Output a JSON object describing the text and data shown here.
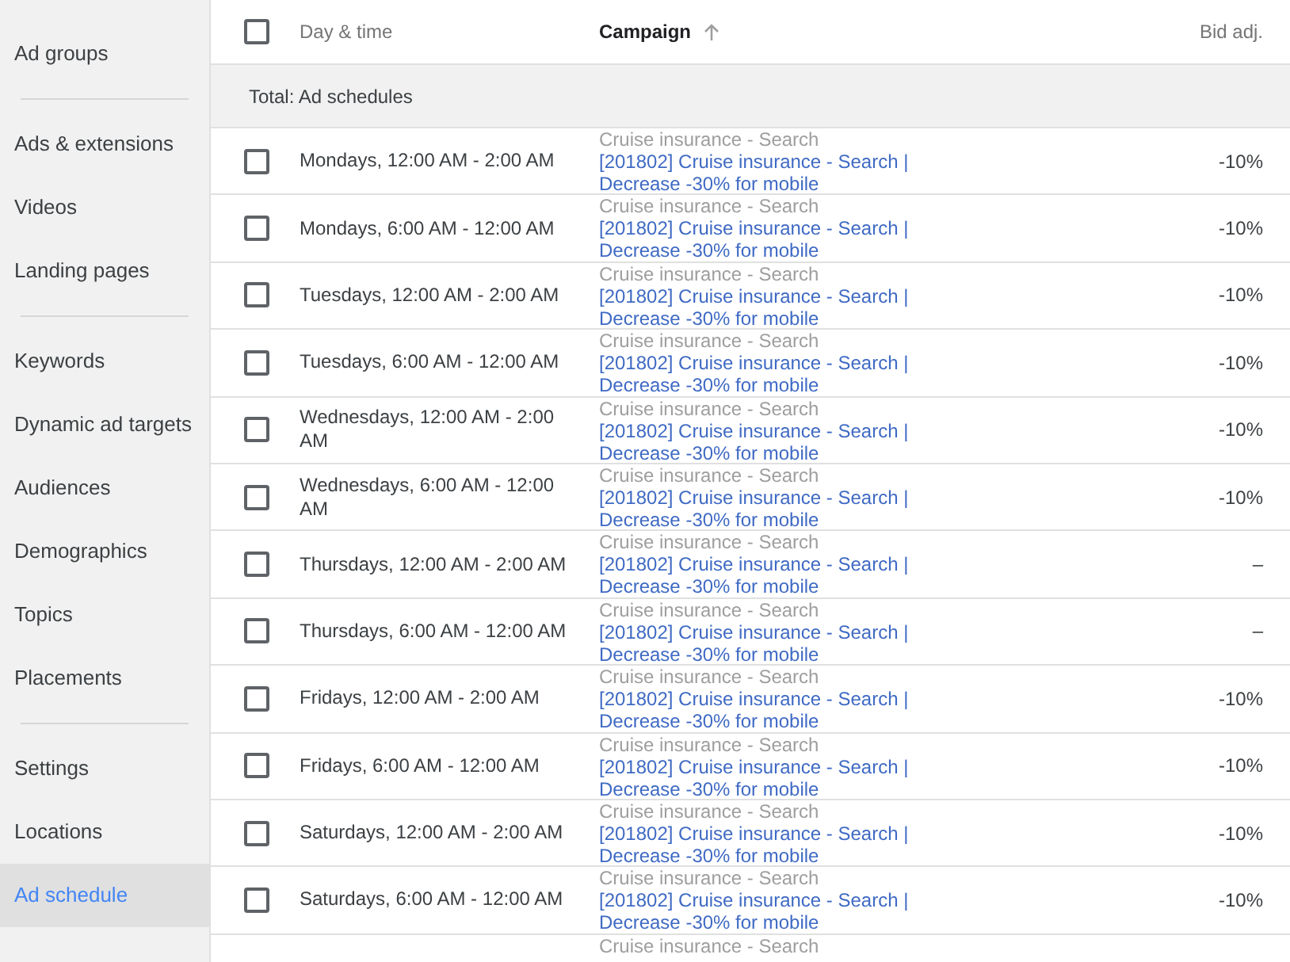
{
  "sidebar": {
    "groups": [
      {
        "items": [
          {
            "label": "Ad groups",
            "selected": false
          }
        ]
      },
      {
        "items": [
          {
            "label": "Ads & extensions",
            "selected": false
          },
          {
            "label": "Videos",
            "selected": false
          },
          {
            "label": "Landing pages",
            "selected": false
          }
        ]
      },
      {
        "items": [
          {
            "label": "Keywords",
            "selected": false
          },
          {
            "label": "Dynamic ad targets",
            "selected": false
          },
          {
            "label": "Audiences",
            "selected": false
          },
          {
            "label": "Demographics",
            "selected": false
          },
          {
            "label": "Topics",
            "selected": false
          },
          {
            "label": "Placements",
            "selected": false
          }
        ]
      },
      {
        "items": [
          {
            "label": "Settings",
            "selected": false
          },
          {
            "label": "Locations",
            "selected": false
          },
          {
            "label": "Ad schedule",
            "selected": true
          }
        ]
      }
    ]
  },
  "table": {
    "select_all_checked": false,
    "columns": [
      {
        "label": "Day & time",
        "sorted": false
      },
      {
        "label": "Campaign",
        "sorted": true
      },
      {
        "label": "Bid adj.",
        "sorted": false
      }
    ],
    "total_label": "Total: Ad schedules",
    "rows": [
      {
        "checked": false,
        "day_time": "Mondays, 12:00 AM - 2:00 AM",
        "campaign_group": "Cruise insurance - Search",
        "campaign": "[201802] Cruise insurance - Search | Decrease -30% for mobile",
        "bid_adj": "-10%"
      },
      {
        "checked": false,
        "day_time": "Mondays, 6:00 AM - 12:00 AM",
        "campaign_group": "Cruise insurance - Search",
        "campaign": "[201802] Cruise insurance - Search | Decrease -30% for mobile",
        "bid_adj": "-10%"
      },
      {
        "checked": false,
        "day_time": "Tuesdays, 12:00 AM - 2:00 AM",
        "campaign_group": "Cruise insurance - Search",
        "campaign": "[201802] Cruise insurance - Search | Decrease -30% for mobile",
        "bid_adj": "-10%"
      },
      {
        "checked": false,
        "day_time": "Tuesdays, 6:00 AM - 12:00 AM",
        "campaign_group": "Cruise insurance - Search",
        "campaign": "[201802] Cruise insurance - Search | Decrease -30% for mobile",
        "bid_adj": "-10%"
      },
      {
        "checked": false,
        "day_time": "Wednesdays, 12:00 AM - 2:00 AM",
        "campaign_group": "Cruise insurance - Search",
        "campaign": "[201802] Cruise insurance - Search | Decrease -30% for mobile",
        "bid_adj": "-10%"
      },
      {
        "checked": false,
        "day_time": "Wednesdays, 6:00 AM - 12:00 AM",
        "campaign_group": "Cruise insurance - Search",
        "campaign": "[201802] Cruise insurance - Search | Decrease -30% for mobile",
        "bid_adj": "-10%"
      },
      {
        "checked": false,
        "day_time": "Thursdays, 12:00 AM - 2:00 AM",
        "campaign_group": "Cruise insurance - Search",
        "campaign": "[201802] Cruise insurance - Search | Decrease -30% for mobile",
        "bid_adj": "–"
      },
      {
        "checked": false,
        "day_time": "Thursdays, 6:00 AM - 12:00 AM",
        "campaign_group": "Cruise insurance - Search",
        "campaign": "[201802] Cruise insurance - Search | Decrease -30% for mobile",
        "bid_adj": "–"
      },
      {
        "checked": false,
        "day_time": "Fridays, 12:00 AM - 2:00 AM",
        "campaign_group": "Cruise insurance - Search",
        "campaign": "[201802] Cruise insurance - Search | Decrease -30% for mobile",
        "bid_adj": "-10%"
      },
      {
        "checked": false,
        "day_time": "Fridays, 6:00 AM - 12:00 AM",
        "campaign_group": "Cruise insurance - Search",
        "campaign": "[201802] Cruise insurance - Search | Decrease -30% for mobile",
        "bid_adj": "-10%"
      },
      {
        "checked": false,
        "day_time": "Saturdays, 12:00 AM - 2:00 AM",
        "campaign_group": "Cruise insurance - Search",
        "campaign": "[201802] Cruise insurance - Search | Decrease -30% for mobile",
        "bid_adj": "-10%"
      },
      {
        "checked": false,
        "day_time": "Saturdays, 6:00 AM - 12:00 AM",
        "campaign_group": "Cruise insurance - Search",
        "campaign": "[201802] Cruise insurance - Search | Decrease -30% for mobile",
        "bid_adj": "-10%"
      },
      {
        "campaign_group": "Cruise insurance - Search"
      }
    ]
  }
}
